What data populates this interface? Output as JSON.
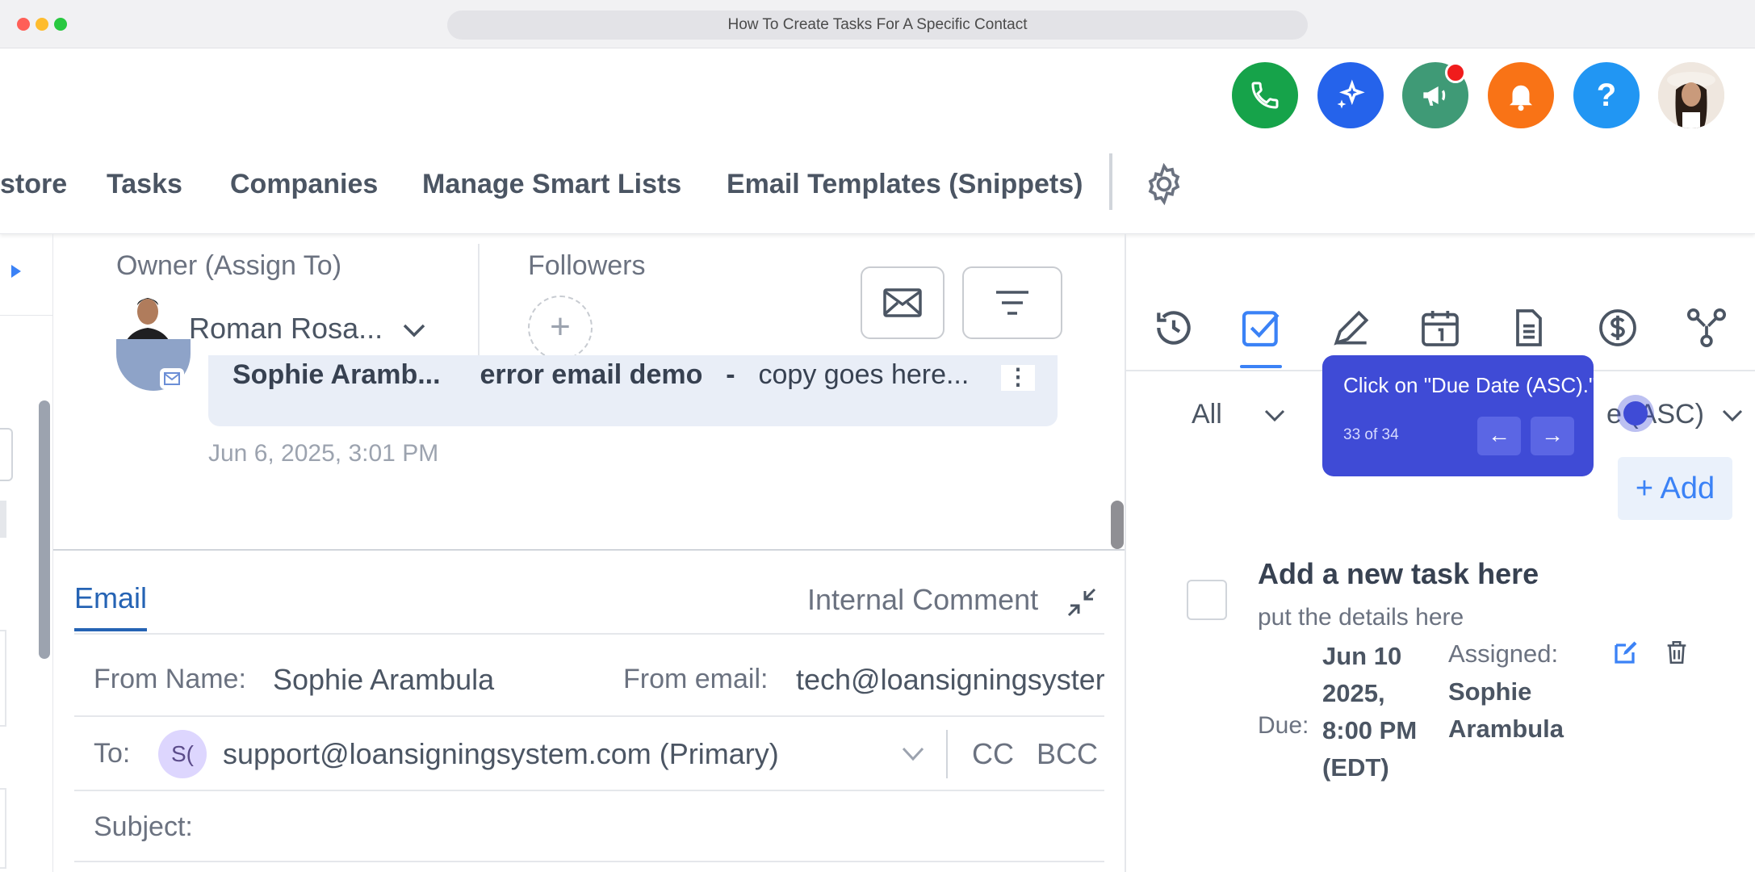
{
  "window": {
    "title": "How To Create Tasks For A Specific Contact"
  },
  "top_icons": [
    {
      "name": "phone-icon",
      "color": "#16a34a"
    },
    {
      "name": "sparkle-icon",
      "color": "#2563eb"
    },
    {
      "name": "megaphone-icon",
      "color": "#3f9a76"
    },
    {
      "name": "bell-icon",
      "color": "#f97316"
    },
    {
      "name": "help-icon",
      "color": "#2196f3"
    }
  ],
  "nav": {
    "items": [
      "store",
      "Tasks",
      "Companies",
      "Manage Smart Lists",
      "Email Templates (Snippets)"
    ]
  },
  "contact_header": {
    "owner_label": "Owner (Assign To)",
    "owner_name": "Roman Rosa...",
    "followers_label": "Followers",
    "add_follower": "+"
  },
  "message": {
    "sender": "Sophie Aramb...",
    "subject": "error email demo",
    "separator": "-",
    "preview": "copy goes here...",
    "timestamp": "Jun 6, 2025, 3:01 PM"
  },
  "compose": {
    "tab_email": "Email",
    "tab_internal": "Internal Comment",
    "from_name_label": "From Name:",
    "from_name_value": "Sophie Arambula",
    "from_email_label": "From email:",
    "from_email_value": "tech@loansigningsyster",
    "to_label": "To:",
    "to_chip": "S(",
    "to_value": "support@loansigningsystem.com (Primary)",
    "cc": "CC",
    "bcc": "BCC",
    "subject_label": "Subject:"
  },
  "tasks_panel": {
    "filter_all": "All",
    "sort_label": "e (ASC)",
    "add_button": "+ Add",
    "task": {
      "title": "Add a new task here",
      "details": "put the details here",
      "due_label": "Due:",
      "due_value": "Jun 10 2025, 8:00 PM (EDT)",
      "assigned_label": "Assigned:",
      "assigned_value": "Sophie Arambula"
    }
  },
  "tooltip": {
    "text": "Click on \"Due Date (ASC).\"",
    "counter": "33 of 34",
    "prev": "←",
    "next": "→"
  },
  "colors": {
    "accent": "#2563b4",
    "tooltip": "#3f4bd6"
  }
}
